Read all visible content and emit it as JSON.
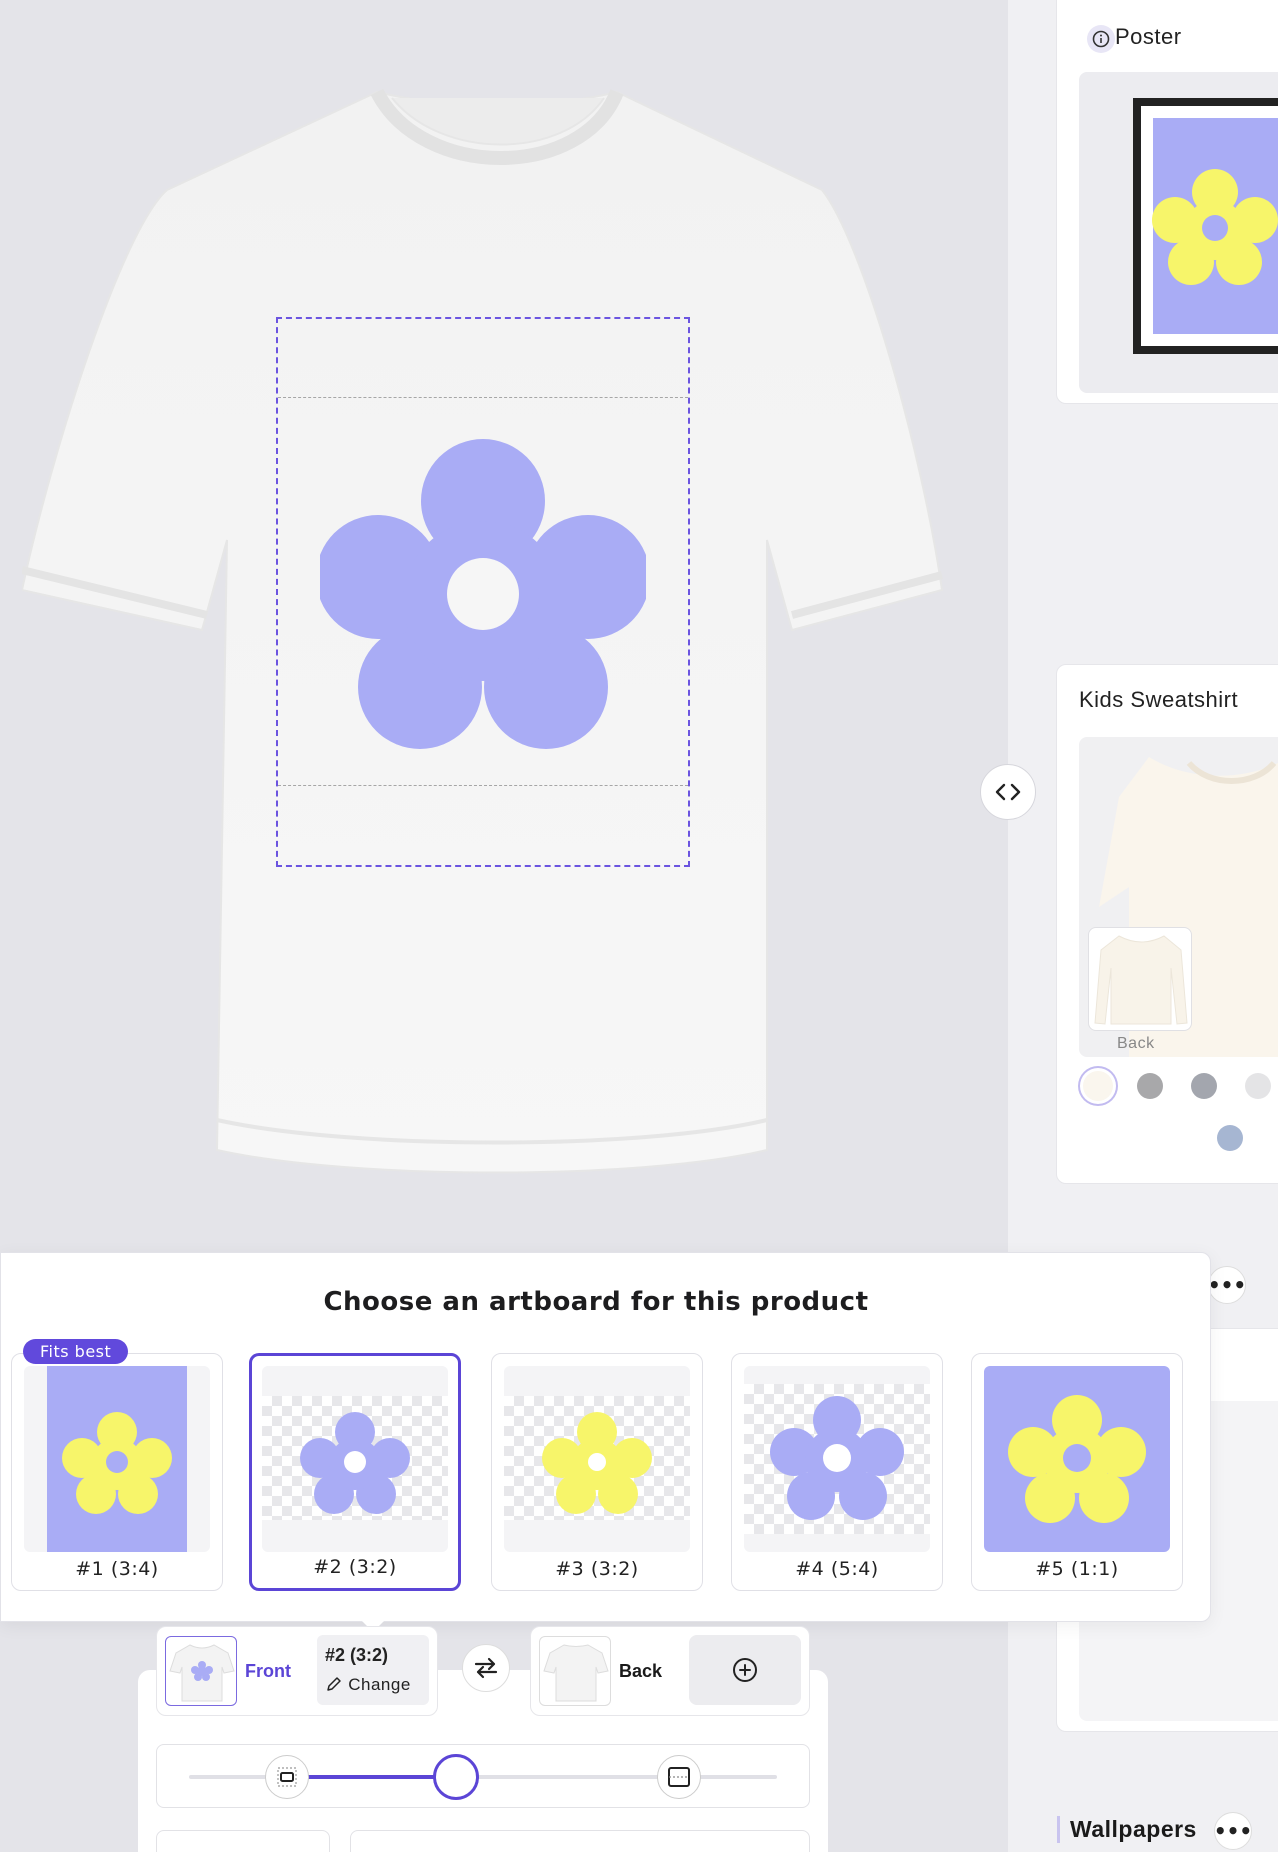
{
  "colors": {
    "accent": "#5b45d6",
    "flower_lavender": "#a9acf5",
    "flower_yellow": "#f7f56a"
  },
  "side_panel": {
    "poster": {
      "title": "Poster",
      "icon": "info-icon"
    },
    "kids_sweatshirt": {
      "title": "Kids Sweatshirt",
      "back_label": "Back",
      "swatches": [
        "#faf6ee",
        "#a8a8aa",
        "#a3a6ae",
        "#e4e4e6",
        "#a6b6d2"
      ]
    },
    "wallpapers": {
      "title": "Wallpapers",
      "more_label": "•••"
    },
    "more_label": "•••"
  },
  "chooser": {
    "title": "Choose an artboard for this product",
    "badge": "Fits best",
    "artboards": [
      {
        "label": "#1 (3:4)"
      },
      {
        "label": "#2 (3:2)"
      },
      {
        "label": "#3 (3:2)"
      },
      {
        "label": "#4 (5:4)"
      },
      {
        "label": "#5 (1:1)"
      }
    ]
  },
  "controls": {
    "front_label": "Front",
    "back_label": "Back",
    "current_artboard": "#2 (3:2)",
    "change_label": "Change",
    "scale_value": 0.46
  }
}
